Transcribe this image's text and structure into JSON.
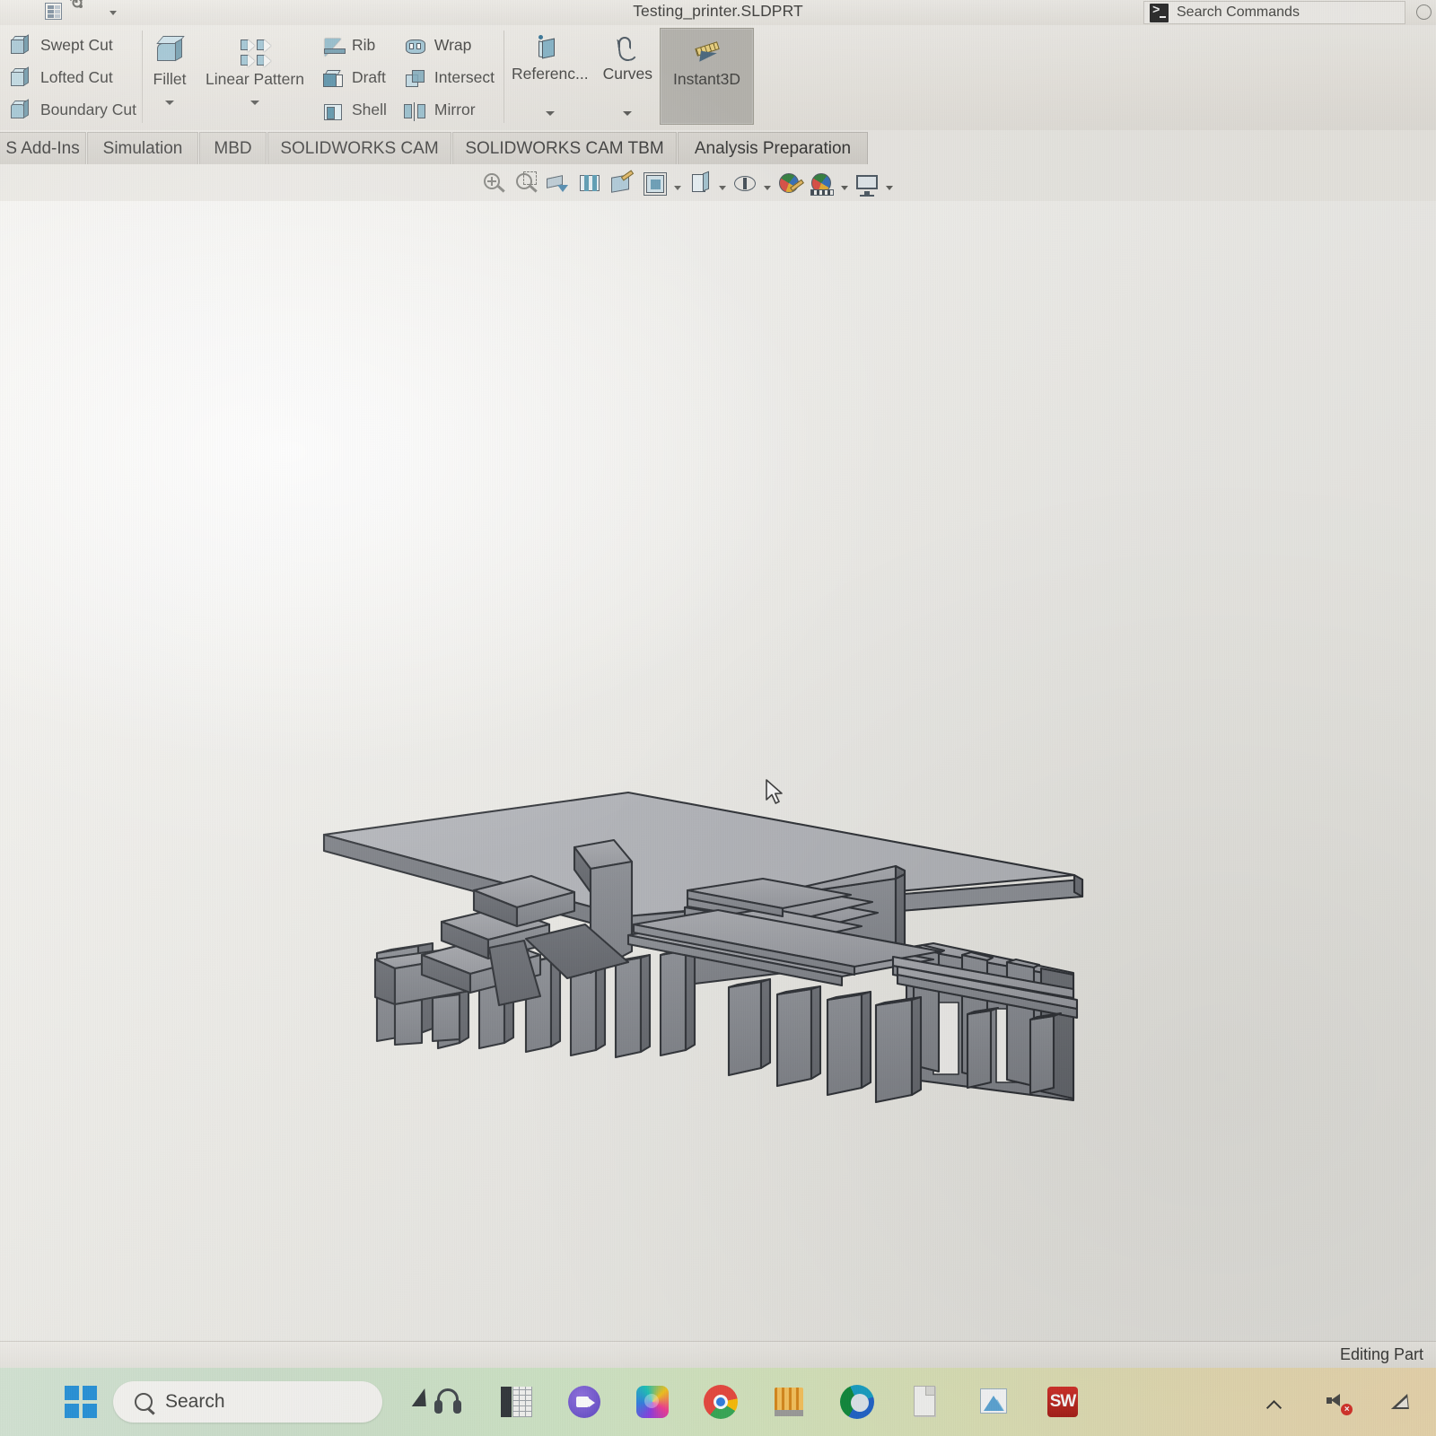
{
  "window": {
    "document_title": "Testing_printer.SLDPRT",
    "search_placeholder": "Search Commands"
  },
  "quick_access": {
    "items": [
      {
        "name": "rebuild-indicator-icon",
        "label": "Rebuild"
      },
      {
        "name": "options-list-icon",
        "label": "Options List"
      },
      {
        "name": "gear-icon",
        "label": "Options"
      },
      {
        "name": "chevron-down-icon",
        "label": "Customize Quick Access Toolbar"
      }
    ]
  },
  "ribbon": {
    "cut_group": [
      {
        "label": "Swept Cut",
        "icon": "swept-cut-icon"
      },
      {
        "label": "Lofted Cut",
        "icon": "lofted-cut-icon"
      },
      {
        "label": "Boundary Cut",
        "icon": "boundary-cut-icon"
      }
    ],
    "feature_big": [
      {
        "label": "Fillet",
        "icon": "fillet-icon",
        "has_dropdown": true
      },
      {
        "label": "Linear Pattern",
        "icon": "linear-pattern-icon",
        "has_dropdown": true
      }
    ],
    "col_rib": [
      {
        "label": "Rib",
        "icon": "rib-icon"
      },
      {
        "label": "Draft",
        "icon": "draft-icon"
      },
      {
        "label": "Shell",
        "icon": "shell-icon"
      }
    ],
    "col_wrap": [
      {
        "label": "Wrap",
        "icon": "wrap-icon"
      },
      {
        "label": "Intersect",
        "icon": "intersect-icon"
      },
      {
        "label": "Mirror",
        "icon": "mirror-icon"
      }
    ],
    "geometry_group": [
      {
        "label": "Referenc...",
        "icon": "reference-geometry-icon",
        "has_dropdown": true,
        "active": false
      },
      {
        "label": "Curves",
        "icon": "curves-icon",
        "has_dropdown": true,
        "active": false
      },
      {
        "label": "Instant3D",
        "icon": "instant3d-icon",
        "has_dropdown": false,
        "active": true
      }
    ]
  },
  "tabs": [
    {
      "label": "S Add-Ins",
      "selected": false
    },
    {
      "label": "Simulation",
      "selected": false
    },
    {
      "label": "MBD",
      "selected": false
    },
    {
      "label": "SOLIDWORKS CAM",
      "selected": false
    },
    {
      "label": "SOLIDWORKS CAM TBM",
      "selected": false
    },
    {
      "label": "Analysis Preparation",
      "selected": false
    }
  ],
  "view_toolbar": [
    {
      "name": "zoom-to-fit-icon",
      "label": "Zoom to Fit",
      "has_dropdown": false
    },
    {
      "name": "zoom-to-area-icon",
      "label": "Zoom to Area",
      "has_dropdown": false
    },
    {
      "name": "zoom-in-out-icon",
      "label": "Zoom In/Out",
      "has_dropdown": false
    },
    {
      "name": "previous-view-icon",
      "label": "Previous View",
      "has_dropdown": false
    },
    {
      "name": "section-view-icon",
      "label": "Section View",
      "has_dropdown": false
    },
    {
      "name": "view-orientation-icon",
      "label": "View Orientation",
      "has_dropdown": true
    },
    {
      "name": "display-style-icon",
      "label": "Display Style",
      "has_dropdown": true
    },
    {
      "name": "hide-show-items-icon",
      "label": "Hide/Show Items",
      "has_dropdown": true
    },
    {
      "name": "edit-appearance-icon",
      "label": "Edit Appearance",
      "has_dropdown": false
    },
    {
      "name": "apply-scene-icon",
      "label": "Apply Scene",
      "has_dropdown": true
    },
    {
      "name": "view-settings-icon",
      "label": "View Settings",
      "has_dropdown": true
    }
  ],
  "viewport": {
    "model_name": "Testing_printer",
    "model_description": "Shaded isometric 3D part: rectangular baseplate with an array of upright rectangular fins and stepped blocks"
  },
  "status_bar": {
    "mode": "Editing Part"
  },
  "taskbar": {
    "start_label": "Start",
    "search_placeholder": "Search",
    "apps": [
      {
        "name": "headphones-icon",
        "label": "Headphones"
      },
      {
        "name": "calculator-icon",
        "label": "Calculator"
      },
      {
        "name": "teams-icon",
        "label": "Microsoft Teams"
      },
      {
        "name": "photos-icon",
        "label": "Photos"
      },
      {
        "name": "chrome-icon",
        "label": "Google Chrome"
      },
      {
        "name": "excel-icon",
        "label": "Excel"
      },
      {
        "name": "edge-icon",
        "label": "Microsoft Edge"
      },
      {
        "name": "document-icon",
        "label": "Document"
      },
      {
        "name": "blue-app-icon",
        "label": "Pictures App"
      },
      {
        "name": "solidworks-icon",
        "label": "SW"
      }
    ],
    "tray": [
      {
        "name": "chevron-up-icon",
        "label": "Show hidden icons"
      },
      {
        "name": "speaker-muted-icon",
        "label": "Volume muted"
      },
      {
        "name": "network-icon",
        "label": "Network"
      }
    ]
  }
}
